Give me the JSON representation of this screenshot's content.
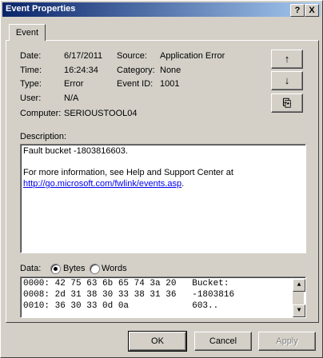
{
  "window": {
    "title": "Event Properties",
    "help_btn": "?",
    "close_btn": "X"
  },
  "tab": {
    "label": "Event"
  },
  "fields": {
    "date_label": "Date:",
    "date_value": "6/17/2011",
    "time_label": "Time:",
    "time_value": "16:24:34",
    "type_label": "Type:",
    "type_value": "Error",
    "user_label": "User:",
    "user_value": "N/A",
    "computer_label": "Computer:",
    "computer_value": "SERIOUSTOOL04",
    "source_label": "Source:",
    "source_value": "Application Error",
    "category_label": "Category:",
    "category_value": "None",
    "eventid_label": "Event ID:",
    "eventid_value": "1001"
  },
  "side_buttons": {
    "up": "↑",
    "down": "↓",
    "copy": "⎘"
  },
  "description": {
    "label": "Description:",
    "line1": "Fault bucket -1803816603.",
    "line2": "For more information, see Help and Support Center at",
    "link": "http://go.microsoft.com/fwlink/events.asp",
    "link_suffix": "."
  },
  "data": {
    "label": "Data:",
    "bytes_label": "Bytes",
    "words_label": "Words",
    "lines": [
      "0000: 42 75 63 6b 65 74 3a 20   Bucket: ",
      "0008: 2d 31 38 30 33 38 31 36   -1803816",
      "0010: 36 30 33 0d 0a            603.."
    ]
  },
  "buttons": {
    "ok": "OK",
    "cancel": "Cancel",
    "apply": "Apply"
  }
}
